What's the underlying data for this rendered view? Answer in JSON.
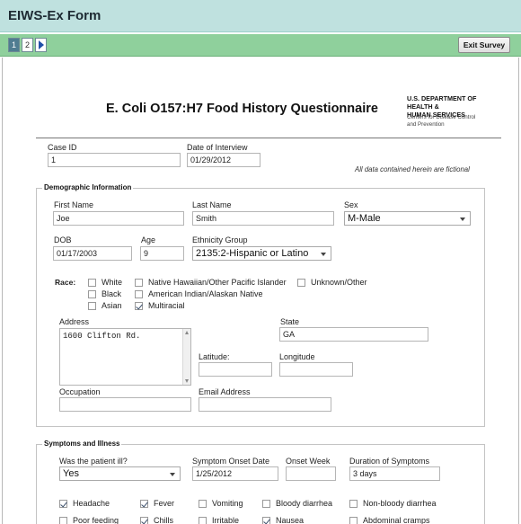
{
  "app": {
    "title": "EIWS-Ex Form"
  },
  "nav": {
    "page1": "1",
    "page2": "2",
    "exit_label": "Exit Survey"
  },
  "header": {
    "title": "E. Coli O157:H7 Food History Questionnaire",
    "dept_line1": "U.S. DEPARTMENT OF",
    "dept_line2": "HEALTH &",
    "dept_line3": "HUMAN SERVICES",
    "cdc_line1": "Centers for Disease Control",
    "cdc_line2": "and Prevention"
  },
  "case": {
    "case_id_label": "Case ID",
    "case_id_value": "1",
    "interview_label": "Date of Interview",
    "interview_value": "01/29/2012",
    "fictional_note": "All data contained herein are fictional"
  },
  "demographics": {
    "legend": "Demographic Information",
    "first_name_label": "First Name",
    "first_name_value": "Joe",
    "last_name_label": "Last Name",
    "last_name_value": "Smith",
    "sex_label": "Sex",
    "sex_value": "M-Male",
    "dob_label": "DOB",
    "dob_value": "01/17/2003",
    "age_label": "Age",
    "age_value": "9",
    "ethnicity_label": "Ethnicity Group",
    "ethnicity_value": "2135:2-Hispanic or Latino",
    "race_label": "Race:",
    "race_options": [
      {
        "label": "White",
        "checked": false
      },
      {
        "label": "Black",
        "checked": false
      },
      {
        "label": "Asian",
        "checked": false
      },
      {
        "label": "Native Hawaiian/Other Pacific Islander",
        "checked": false
      },
      {
        "label": "American Indian/Alaskan Native",
        "checked": false
      },
      {
        "label": "Multiracial",
        "checked": true
      },
      {
        "label": "Unknown/Other",
        "checked": false
      }
    ],
    "address_label": "Address",
    "address_value": "1600 Clifton Rd.",
    "state_label": "State",
    "state_value": "GA",
    "latitude_label": "Latitude:",
    "latitude_value": "",
    "longitude_label": "Longitude",
    "longitude_value": "",
    "occupation_label": "Occupation",
    "occupation_value": "",
    "email_label": "Email Address",
    "email_value": ""
  },
  "symptoms": {
    "legend": "Symptoms and Illness",
    "ill_label": "Was the patient ill?",
    "ill_value": "Yes",
    "onset_date_label": "Symptom Onset Date",
    "onset_date_value": "1/25/2012",
    "onset_week_label": "Onset Week",
    "onset_week_value": "",
    "duration_label": "Duration of Symptoms",
    "duration_value": "3 days",
    "items": [
      {
        "label": "Headache",
        "checked": true
      },
      {
        "label": "Fever",
        "checked": true
      },
      {
        "label": "Vomiting",
        "checked": false
      },
      {
        "label": "Bloody diarrhea",
        "checked": false
      },
      {
        "label": "Non-bloody diarrhea",
        "checked": false
      },
      {
        "label": "Poor feeding",
        "checked": false
      },
      {
        "label": "Chills",
        "checked": true
      },
      {
        "label": "Irritable",
        "checked": false
      },
      {
        "label": "Nausea",
        "checked": true
      },
      {
        "label": "Abdominal cramps",
        "checked": false
      }
    ]
  },
  "colors": {
    "titlebar": "#bfe1df",
    "navbar": "#8fd09c",
    "active_page": "#4f7c91"
  }
}
